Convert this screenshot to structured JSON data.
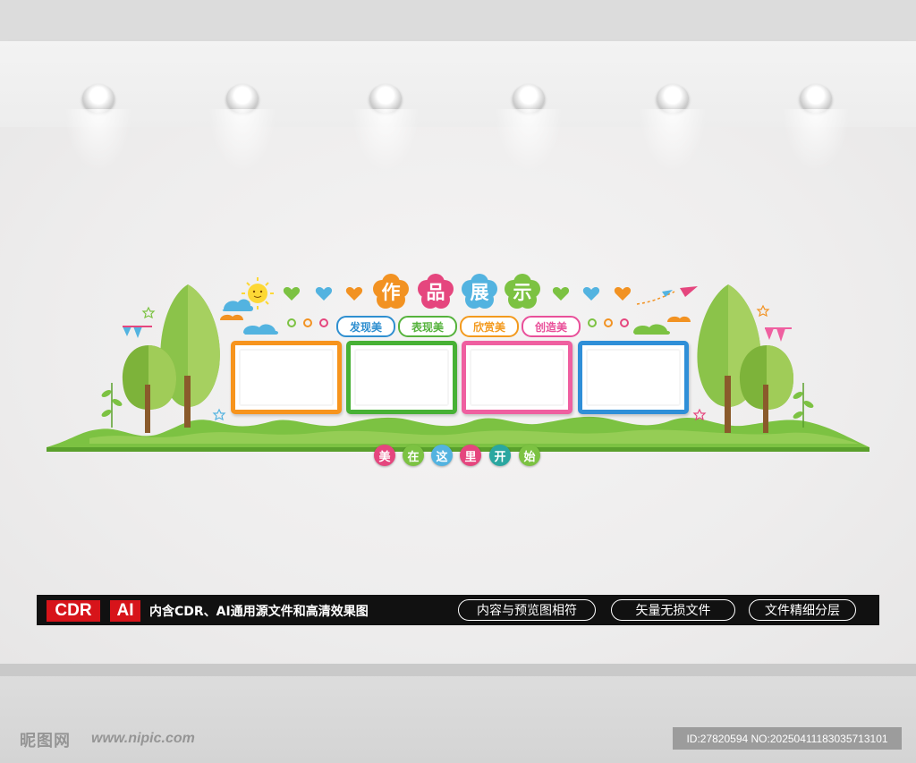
{
  "board": {
    "title_chars": [
      "作",
      "品",
      "展",
      "示"
    ],
    "title_colors": [
      "#f29222",
      "#e5467e",
      "#53b3e0",
      "#7cc242"
    ],
    "subtitle_pills": [
      {
        "label": "发现美",
        "color": "#2f8fd0"
      },
      {
        "label": "表现美",
        "color": "#56b33d"
      },
      {
        "label": "欣赏美",
        "color": "#f39a1e"
      },
      {
        "label": "创造美",
        "color": "#e9509a"
      }
    ],
    "frame_colors": [
      "#f7941d",
      "#47b135",
      "#ef5fa0",
      "#2f8fd8"
    ],
    "motto_chars": [
      "美",
      "在",
      "这",
      "里",
      "开",
      "始"
    ],
    "motto_colors": [
      "#e5467e",
      "#7cc242",
      "#53b3e0",
      "#e5467e",
      "#2aa7a0",
      "#7cc242"
    ]
  },
  "banner": {
    "format_badges": [
      "CDR",
      "AI"
    ],
    "description": "内含CDR、AI通用源文件和高清效果图",
    "features": [
      "内容与预览图相符",
      "矢量无损文件",
      "文件精细分层"
    ]
  },
  "watermark": {
    "site_name": "昵图网",
    "url": "www.nipic.com",
    "id_text": "ID:27820594 NO:20250411183035713101"
  }
}
